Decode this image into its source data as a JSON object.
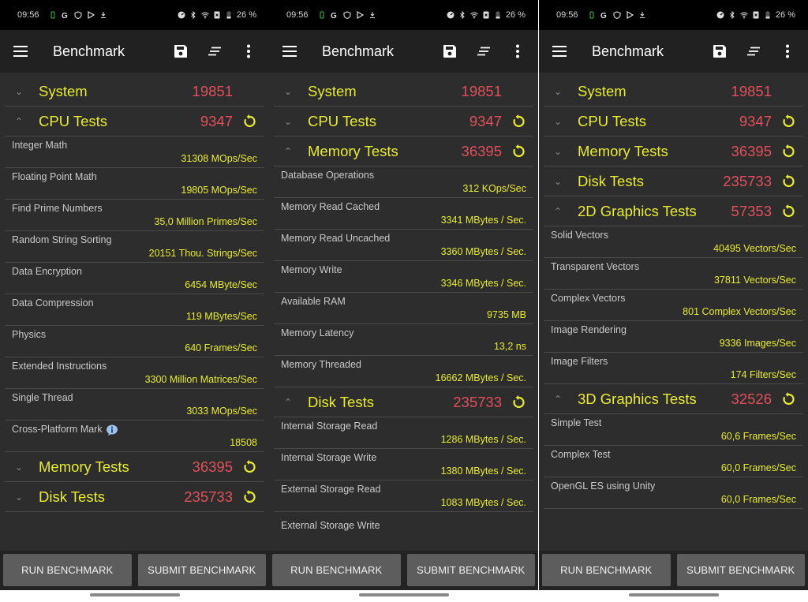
{
  "status_bar": {
    "time": "09:56",
    "left_icons": [
      "battery-saver-icon",
      "google-icon",
      "shield-icon",
      "play-store-icon",
      "download-icon"
    ],
    "right_icons": [
      "data-saver-icon",
      "bluetooth-icon",
      "wifi-icon",
      "sim-off-icon",
      "battery-icon"
    ],
    "battery": "26 %"
  },
  "app_bar": {
    "title": "Benchmark",
    "menu_icon": "hamburger-menu-icon",
    "actions": [
      "save-icon",
      "sort-icon",
      "more-vert-icon"
    ]
  },
  "colors": {
    "title_yellow": "#e8ec2b",
    "score_red": "#e0505a",
    "background": "#2d2d2d",
    "appbar": "#212121"
  },
  "buttons": {
    "run": "RUN BENCHMARK",
    "submit": "SUBMIT BENCHMARK"
  },
  "screens": [
    {
      "sections": [
        {
          "title": "System",
          "score": "19851",
          "expanded": false,
          "refresh": false,
          "rows": []
        },
        {
          "title": "CPU Tests",
          "score": "9347",
          "expanded": true,
          "refresh": true,
          "rows": [
            {
              "label": "Integer Math",
              "value": "31308 MOps/Sec"
            },
            {
              "label": "Floating Point Math",
              "value": "19805 MOps/Sec"
            },
            {
              "label": "Find Prime Numbers",
              "value": "35,0 Million Primes/Sec"
            },
            {
              "label": "Random String Sorting",
              "value": "20151 Thou. Strings/Sec"
            },
            {
              "label": "Data Encryption",
              "value": "6454 MByte/Sec"
            },
            {
              "label": "Data Compression",
              "value": "119 MBytes/Sec"
            },
            {
              "label": "Physics",
              "value": "640 Frames/Sec"
            },
            {
              "label": "Extended Instructions",
              "value": "3300 Million Matrices/Sec"
            },
            {
              "label": "Single Thread",
              "value": "3033 MOps/Sec"
            },
            {
              "label": "Cross-Platform Mark",
              "value": "18508",
              "info": true
            }
          ]
        },
        {
          "title": "Memory Tests",
          "score": "36395",
          "expanded": false,
          "refresh": true,
          "rows": []
        },
        {
          "title": "Disk Tests",
          "score": "235733",
          "expanded": false,
          "refresh": true,
          "rows": []
        }
      ]
    },
    {
      "sections": [
        {
          "title": "System",
          "score": "19851",
          "expanded": false,
          "refresh": false,
          "rows": []
        },
        {
          "title": "CPU Tests",
          "score": "9347",
          "expanded": false,
          "refresh": true,
          "rows": []
        },
        {
          "title": "Memory Tests",
          "score": "36395",
          "expanded": true,
          "refresh": true,
          "rows": [
            {
              "label": "Database Operations",
              "value": "312 KOps/Sec"
            },
            {
              "label": "Memory Read Cached",
              "value": "3341 MBytes / Sec."
            },
            {
              "label": "Memory Read Uncached",
              "value": "3360 MBytes / Sec."
            },
            {
              "label": "Memory Write",
              "value": "3346 MBytes / Sec."
            },
            {
              "label": "Available RAM",
              "value": "9735 MB"
            },
            {
              "label": "Memory Latency",
              "value": "13,2 ns"
            },
            {
              "label": "Memory Threaded",
              "value": "16662 MBytes / Sec."
            }
          ]
        },
        {
          "title": "Disk Tests",
          "score": "235733",
          "expanded": true,
          "refresh": true,
          "rows": [
            {
              "label": "Internal Storage Read",
              "value": "1286 MBytes / Sec."
            },
            {
              "label": "Internal Storage Write",
              "value": "1380 MBytes / Sec."
            },
            {
              "label": "External Storage Read",
              "value": "1083 MBytes / Sec."
            },
            {
              "label": "External Storage Write",
              "value": "",
              "partial": true
            }
          ]
        }
      ]
    },
    {
      "sections": [
        {
          "title": "System",
          "score": "19851",
          "expanded": false,
          "refresh": false,
          "rows": []
        },
        {
          "title": "CPU Tests",
          "score": "9347",
          "expanded": false,
          "refresh": true,
          "rows": []
        },
        {
          "title": "Memory Tests",
          "score": "36395",
          "expanded": false,
          "refresh": true,
          "rows": []
        },
        {
          "title": "Disk Tests",
          "score": "235733",
          "expanded": false,
          "refresh": true,
          "rows": []
        },
        {
          "title": "2D Graphics Tests",
          "score": "57353",
          "expanded": true,
          "refresh": true,
          "rows": [
            {
              "label": "Solid Vectors",
              "value": "40495 Vectors/Sec"
            },
            {
              "label": "Transparent Vectors",
              "value": "37811 Vectors/Sec"
            },
            {
              "label": "Complex Vectors",
              "value": "801 Complex Vectors/Sec"
            },
            {
              "label": "Image Rendering",
              "value": "9336 Images/Sec"
            },
            {
              "label": "Image Filters",
              "value": "174 Filters/Sec"
            }
          ]
        },
        {
          "title": "3D Graphics Tests",
          "score": "32526",
          "expanded": true,
          "refresh": true,
          "rows": [
            {
              "label": "Simple Test",
              "value": "60,6 Frames/Sec"
            },
            {
              "label": "Complex Test",
              "value": "60,0 Frames/Sec"
            },
            {
              "label": "OpenGL ES using Unity",
              "value": "60,0 Frames/Sec"
            }
          ]
        }
      ]
    }
  ]
}
